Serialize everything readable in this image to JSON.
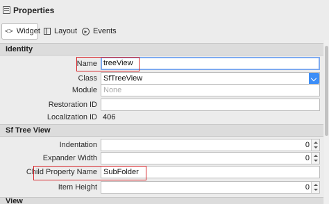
{
  "window": {
    "title": "Properties",
    "icon": "properties-panel-icon"
  },
  "tabs": [
    {
      "label": "Widget",
      "icon": "widget-icon",
      "active": true
    },
    {
      "label": "Layout",
      "icon": "layout-icon",
      "active": false
    },
    {
      "label": "Events",
      "icon": "events-icon",
      "active": false
    }
  ],
  "identity": {
    "header": "Identity",
    "name": {
      "label": "Name",
      "value": "treeView"
    },
    "class": {
      "label": "Class",
      "value": "SfTreeView"
    },
    "module": {
      "label": "Module",
      "placeholder": "None"
    },
    "restoration_id": {
      "label": "Restoration ID",
      "value": ""
    },
    "localization_id": {
      "label": "Localization ID",
      "value": "406"
    }
  },
  "sf_tree_view": {
    "header": "Sf Tree View",
    "indentation": {
      "label": "Indentation",
      "value": "0"
    },
    "expander_width": {
      "label": "Expander Width",
      "value": "0"
    },
    "child_property_name": {
      "label": "Child Property Name",
      "value": "SubFolder"
    },
    "item_height": {
      "label": "Item Height",
      "value": "0"
    }
  },
  "view": {
    "header": "View"
  },
  "colors": {
    "highlight_box": "#d7262b",
    "focus_ring": "#7eaaf0",
    "dropdown_accent": "#3d8ef7"
  }
}
